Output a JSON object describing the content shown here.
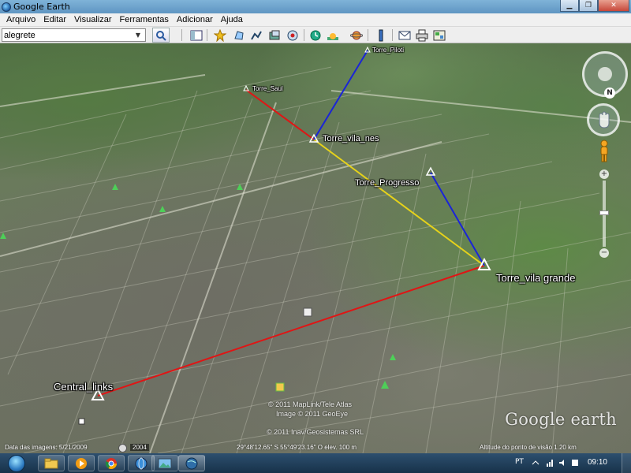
{
  "window": {
    "title": "Google Earth",
    "minimize_icon": "minimize-icon",
    "maximize_icon": "restore-icon",
    "close_icon": "close-icon"
  },
  "menu": {
    "items": [
      "Arquivo",
      "Editar",
      "Visualizar",
      "Ferramentas",
      "Adicionar",
      "Ajuda"
    ]
  },
  "toolbar": {
    "search_value": "alegrete",
    "search_icon": "magnifier-icon",
    "buttons": [
      "sidebar-toggle-icon",
      "add-placemark-icon",
      "add-polygon-icon",
      "add-path-icon",
      "add-overlay-icon",
      "record-tour-icon",
      "historical-imagery-icon",
      "sunlight-icon",
      "planets-icon",
      "ruler-icon",
      "email-icon",
      "print-icon",
      "view-in-maps-icon"
    ]
  },
  "map": {
    "placemarks": [
      {
        "name": "Central_links",
        "size": "big"
      },
      {
        "name": "Torre_vila grande",
        "size": "big"
      },
      {
        "name": "Torre_vila_nes",
        "size": "med"
      },
      {
        "name": "Torre_Progresso",
        "size": "med"
      },
      {
        "name": "Torre_Saul",
        "size": "small"
      },
      {
        "name": "Torre_Piloti",
        "size": "small"
      }
    ],
    "links": [
      {
        "from": "Central_links",
        "to": "Torre_vila grande",
        "color": "#e01515"
      },
      {
        "from": "Torre_vila grande",
        "to": "Torre_vila_nes",
        "color": "#e6d21a"
      },
      {
        "from": "Torre_vila grande",
        "to": "Torre_Progresso",
        "color": "#1a24d8"
      },
      {
        "from": "Torre_vila_nes",
        "to": "Torre_Saul",
        "color": "#e01515"
      },
      {
        "from": "Torre_vila_nes",
        "to": "Torre_Piloti",
        "color": "#1a24d8"
      }
    ],
    "copyrights": [
      "© 2011 MapLink/Tele Atlas",
      "Image © 2011 GeoEye",
      "© 2011 Inav/Geosistemas SRL"
    ],
    "logo": "Google earth",
    "nav_north": "N"
  },
  "status": {
    "imagery_date": "Data das imagens: 5/21/2009",
    "year": "2004",
    "coords": "29°48'12.65\" S  55°49'23.16\" O  elev.  100 m",
    "eye_alt": "Altitude do ponto de visão    1.20 km"
  },
  "taskbar": {
    "apps": [
      "folder-icon",
      "media-player-icon",
      "chrome-icon",
      "photo-viewer-icon",
      "google-earth-icon"
    ],
    "language": "PT",
    "time": "09:10"
  },
  "colors": {
    "red_link": "#e01515",
    "yellow_link": "#e6d21a",
    "blue_link": "#1a24d8"
  }
}
